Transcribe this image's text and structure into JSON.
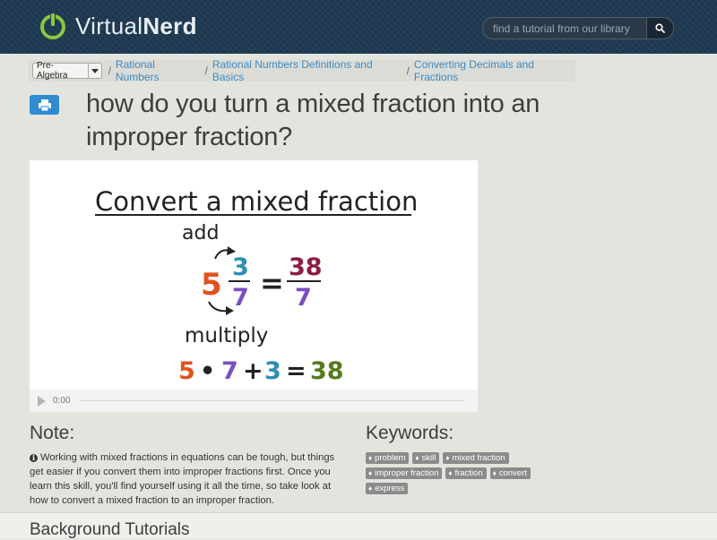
{
  "header": {
    "logo_text_a": "Virtual",
    "logo_text_b": "Nerd",
    "search_placeholder": "find a tutorial from our library"
  },
  "breadcrumb": {
    "subject": "Pre-Algebra",
    "items": [
      "Rational Numbers",
      "Rational Numbers Definitions and Basics",
      "Converting Decimals and Fractions"
    ]
  },
  "page": {
    "title": "how do you turn a mixed fraction into an improper fraction?"
  },
  "video": {
    "slide_title": "Convert a mixed fraction",
    "add_label": "add",
    "whole": "5",
    "numerator": "3",
    "denominator": "7",
    "equals": "=",
    "result_numerator": "38",
    "result_denominator": "7",
    "multiply_label": "multiply",
    "eq_a": "5",
    "eq_dot": "•",
    "eq_b": "7",
    "eq_plus": "+",
    "eq_c": "3",
    "eq_equals": "=",
    "eq_result": "38",
    "time": "0:00",
    "colors": {
      "orange": "#e0531f",
      "teal": "#2a8fb0",
      "maroon": "#8c1c45",
      "purple": "#7a4fc2",
      "green": "#557a1c"
    }
  },
  "note": {
    "heading": "Note:",
    "text": "Working with mixed fractions in equations can be tough, but things get easier if you convert them into improper fractions first. Once you learn this skill, you'll find yourself using it all the time, so take look at how to convert a mixed fraction to an improper fraction."
  },
  "keywords": {
    "heading": "Keywords:",
    "tags": [
      "problem",
      "skill",
      "mixed fraction",
      "improper fraction",
      "fraction",
      "convert",
      "express"
    ]
  },
  "background": {
    "heading": "Background Tutorials"
  }
}
